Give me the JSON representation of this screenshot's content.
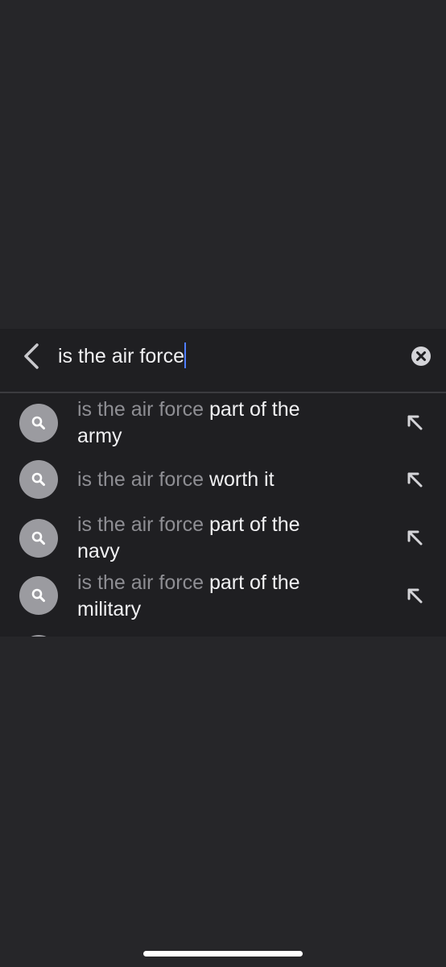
{
  "search": {
    "query": "is the air force",
    "back_icon": "chevron-left-icon",
    "clear_icon": "clear-x-circle-icon"
  },
  "suggestions": [
    {
      "prefix": "is the air force",
      "completion": "part of the army"
    },
    {
      "prefix": "is the air force",
      "completion": "worth it"
    },
    {
      "prefix": "is the air force",
      "completion": "part of the navy"
    },
    {
      "prefix": "is the air force",
      "completion": "part of the military"
    }
  ],
  "icons": {
    "suggestion": "search-icon",
    "fill": "arrow-up-left-icon"
  },
  "colors": {
    "background": "#262629",
    "panel": "#1f1f22",
    "caret": "#4f7dff",
    "prefix_text": "#8e8e93",
    "text": "#f1f1f3"
  }
}
